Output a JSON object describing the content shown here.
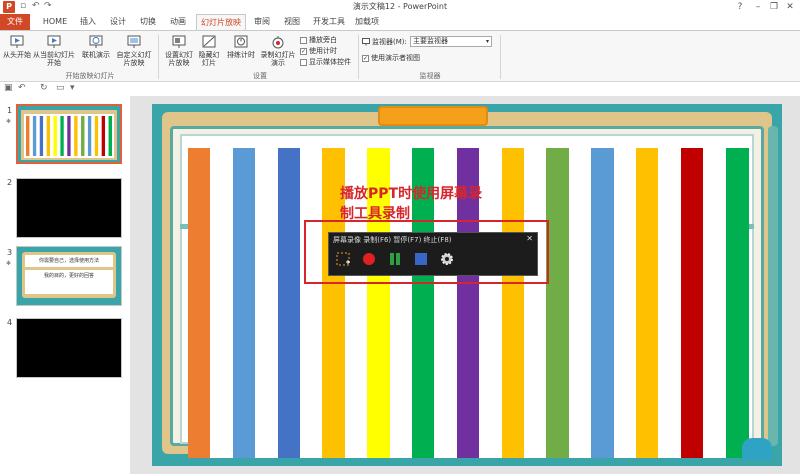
{
  "window": {
    "title": "演示文稿12 - PowerPoint",
    "app_icon": "P",
    "help": "?",
    "min": "–",
    "restore": "❐",
    "close": "✕"
  },
  "tabs": [
    {
      "label": "文件"
    },
    {
      "label": "HOME"
    },
    {
      "label": "插入"
    },
    {
      "label": "设计"
    },
    {
      "label": "切换"
    },
    {
      "label": "动画"
    },
    {
      "label": "幻灯片放映"
    },
    {
      "label": "审阅"
    },
    {
      "label": "视图"
    },
    {
      "label": "开发工具"
    },
    {
      "label": "加载项"
    }
  ],
  "ribbon": {
    "group1": {
      "btn_from_start": "从头开始",
      "btn_from_current": "从当前幻灯片开始",
      "btn_online": "联机演示",
      "btn_custom": "自定义幻灯片放映",
      "label": "开始放映幻灯片"
    },
    "group2": {
      "btn_setup": "设置幻灯片放映",
      "btn_hide": "隐藏幻灯片",
      "btn_rehearse": "排练计时",
      "btn_record": "录制幻灯片演示",
      "chk_narration": "播放旁白",
      "chk_timings": "使用计时",
      "chk_media": "显示媒体控件",
      "label": "设置"
    },
    "group3": {
      "monitor_label": "监视器(M):",
      "monitor_value": "主要监视器",
      "chk_presenter": "使用演示者视图",
      "label": "监视器"
    }
  },
  "slides": [
    {
      "num": "1"
    },
    {
      "num": "2"
    },
    {
      "num": "3",
      "line1": "你需要自己，选择使用方法",
      "line2": "我的目的，更好的回答"
    },
    {
      "num": "4"
    }
  ],
  "annotation": {
    "line1": "播放PPT时使用屏幕录",
    "line2": "制工具录制"
  },
  "recorder": {
    "title": "屏幕录像 录制(F6) 暂停(F7) 终止(F8)",
    "close": "✕"
  },
  "colors": {
    "accent": "#d24726",
    "annotation_red": "#d7262b",
    "bars": [
      "#ed7d31",
      "#ffffff",
      "#5b9bd5",
      "#ffffff",
      "#4472c4",
      "#ffffff",
      "#ffc000",
      "#ffffff",
      "#ffff00",
      "#ffffff",
      "#00b050",
      "#ffffff",
      "#7030a0",
      "#ffffff",
      "#ffc000",
      "#ffffff",
      "#70ad47",
      "#ffffff",
      "#5b9bd5",
      "#ffffff",
      "#ffc000",
      "#ffffff",
      "#c00000",
      "#ffffff",
      "#00b050"
    ]
  }
}
